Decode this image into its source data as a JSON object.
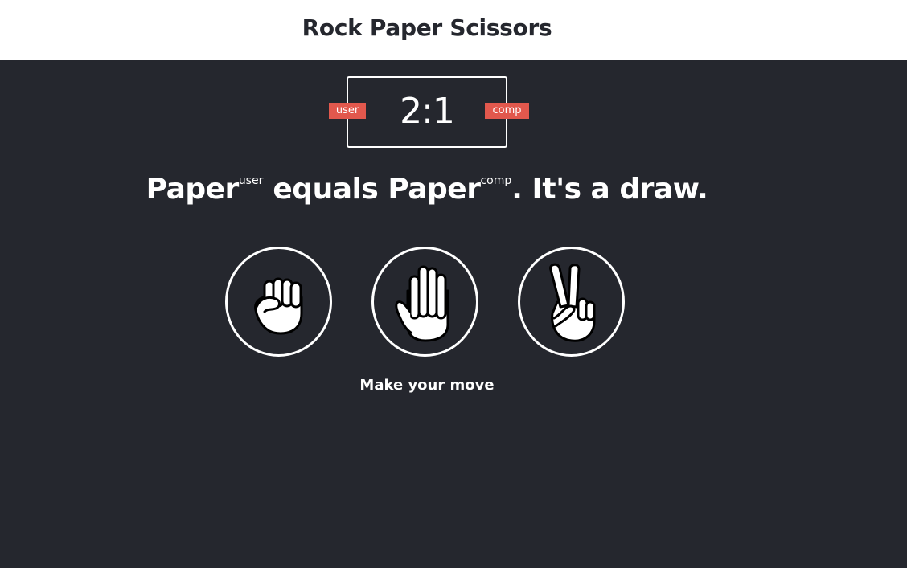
{
  "header": {
    "title": "Rock Paper Scissors"
  },
  "scoreboard": {
    "user_label": "user",
    "comp_label": "comp",
    "score": "2:1",
    "badge_color": "#e2584d"
  },
  "result": {
    "user_choice": "Paper",
    "user_sup": "user",
    "verb": " equals ",
    "comp_choice": "Paper",
    "comp_sup": "comp",
    "outcome": ". It's a draw."
  },
  "choices": [
    {
      "id": "r",
      "icon": "rock-fist-icon"
    },
    {
      "id": "p",
      "icon": "paper-open-hand-icon"
    },
    {
      "id": "s",
      "icon": "scissors-peace-hand-icon"
    }
  ],
  "action_message": "Make your move",
  "colors": {
    "background": "#25272e",
    "header_background": "#ffffff",
    "accent": "#e2584d",
    "text_light": "#ffffff"
  }
}
